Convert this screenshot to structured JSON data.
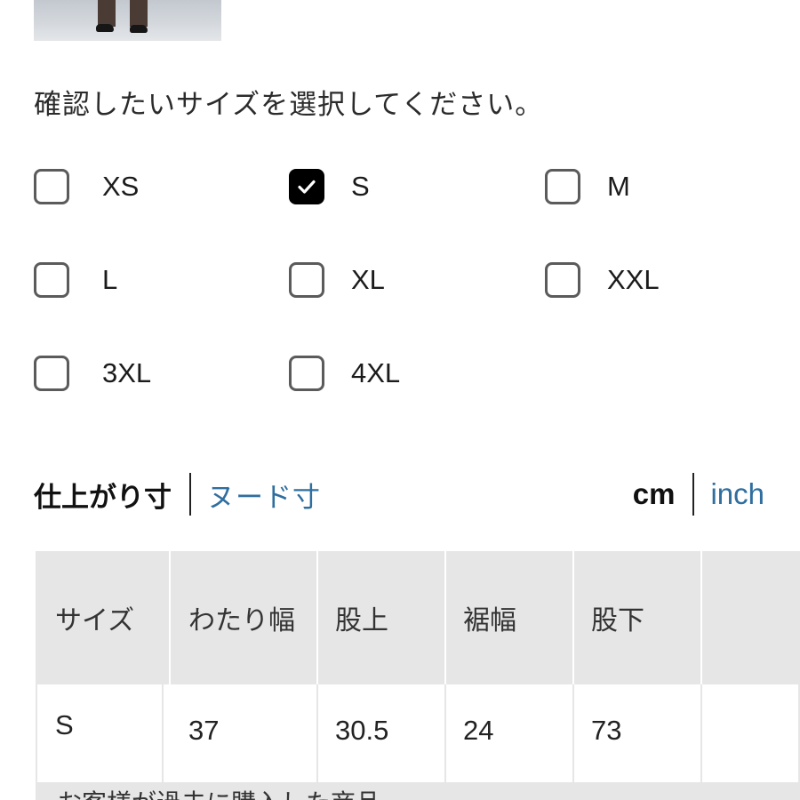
{
  "prompt_text": "確認したいサイズを選択してください。",
  "size_options": [
    {
      "label": "XS",
      "checked": false
    },
    {
      "label": "S",
      "checked": true
    },
    {
      "label": "M",
      "checked": false
    },
    {
      "label": "L",
      "checked": false
    },
    {
      "label": "XL",
      "checked": false
    },
    {
      "label": "XXL",
      "checked": false
    },
    {
      "label": "3XL",
      "checked": false
    },
    {
      "label": "4XL",
      "checked": false
    }
  ],
  "measure_tabs": {
    "active": "仕上がり寸",
    "link": "ヌード寸"
  },
  "units": {
    "active": "cm",
    "link": "inch"
  },
  "table": {
    "headers": [
      "サイズ",
      "わたり幅",
      "股上",
      "裾幅",
      "股下"
    ],
    "row": [
      "S",
      "37",
      "30.5",
      "24",
      "73"
    ],
    "footnote": "お客様が過去に購入した商品"
  },
  "colors": {
    "link": "#2f6e9e",
    "checked": "#000000",
    "table_header_bg": "#e6e6e6"
  },
  "icons": {
    "checkbox_checked": "check-icon"
  }
}
